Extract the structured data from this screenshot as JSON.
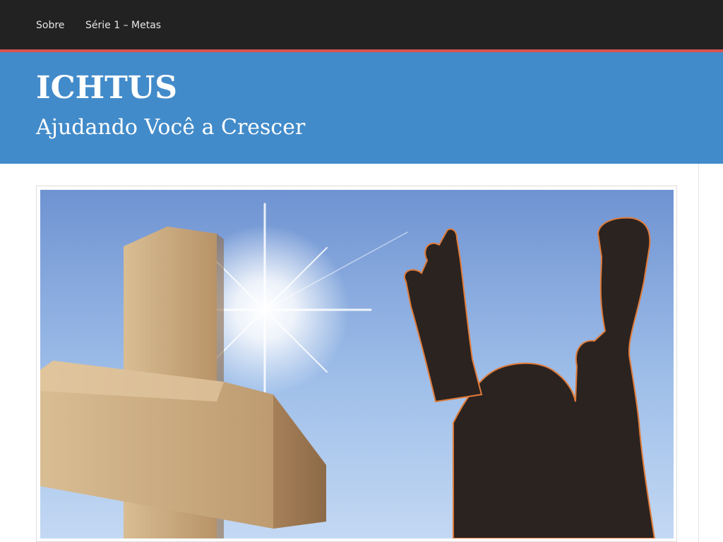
{
  "nav": {
    "items": [
      {
        "label": "Sobre"
      },
      {
        "label": "Série 1 – Metas"
      }
    ]
  },
  "header": {
    "title": "ICHTUS",
    "tagline": "Ajudando Você a Crescer"
  },
  "colors": {
    "nav_bg": "#222222",
    "accent": "#d9534f",
    "header_bg": "#428bca",
    "sky_top": "#6b8fcf",
    "sky_bottom": "#b9d2f2",
    "cross": "#c8a77a"
  },
  "hero": {
    "image_name": "cross-and-raised-hands-photo"
  }
}
